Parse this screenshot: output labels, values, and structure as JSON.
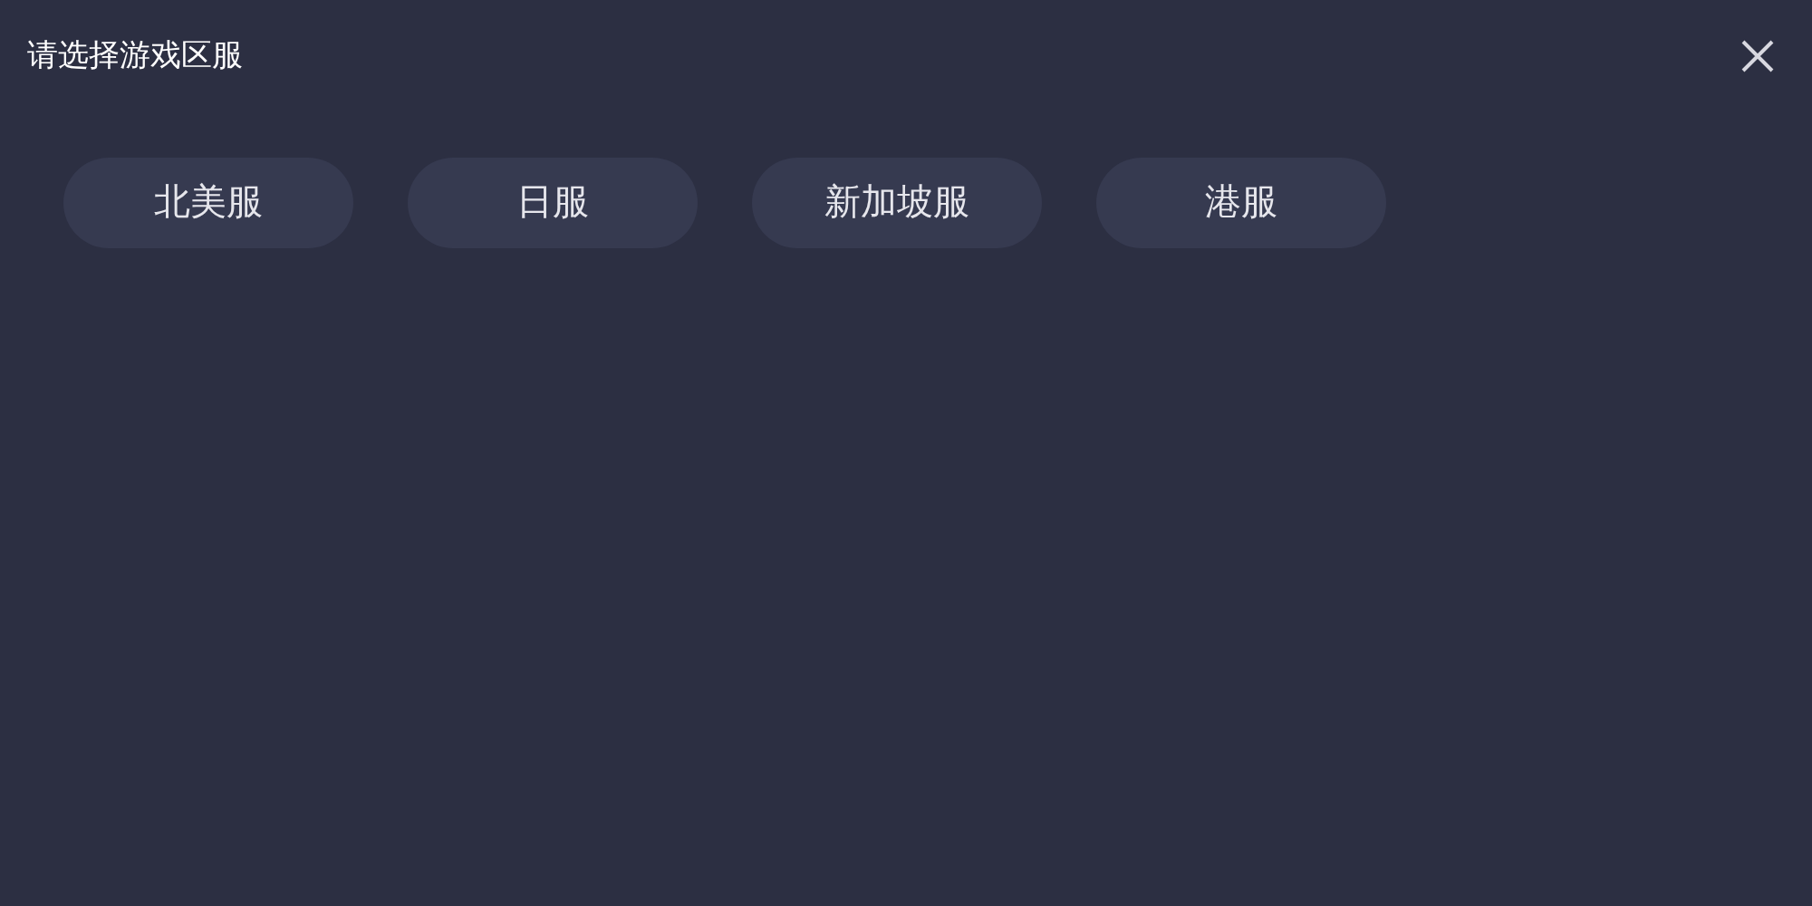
{
  "dialog": {
    "title": "请选择游戏区服"
  },
  "servers": [
    {
      "label": "北美服"
    },
    {
      "label": "日服"
    },
    {
      "label": "新加坡服"
    },
    {
      "label": "港服"
    }
  ]
}
